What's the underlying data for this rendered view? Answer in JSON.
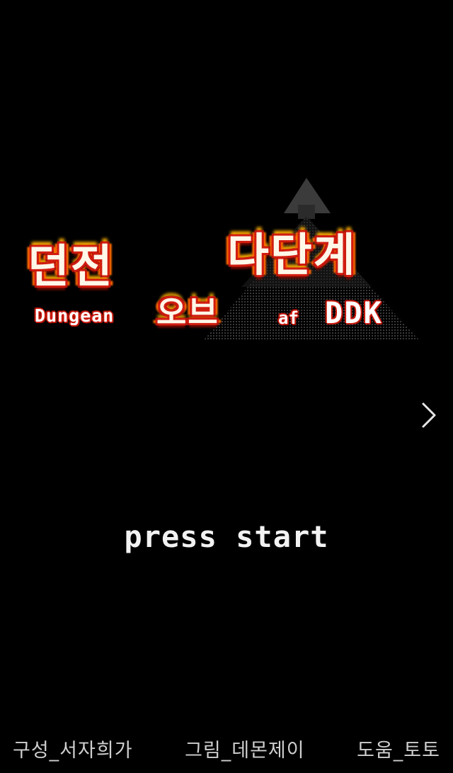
{
  "logo": {
    "line1": "던전",
    "line2": "다단계",
    "line3": "오브",
    "english_dungeon": "Dungean",
    "english_of": "af",
    "english_ddk": "DDK"
  },
  "press_start": "press start",
  "credits": [
    "구성_서자희가",
    "그림_데몬제이",
    "도움_토토"
  ],
  "colors": {
    "background": "#000000",
    "flame_red": "#d11d10",
    "flame_orange": "#ff6a00",
    "text_white": "#f2f2f2",
    "credit_gray": "#cfcfcf"
  },
  "icons": {
    "next": "chevron-right-icon",
    "pyramid": "pyramid-icon"
  }
}
